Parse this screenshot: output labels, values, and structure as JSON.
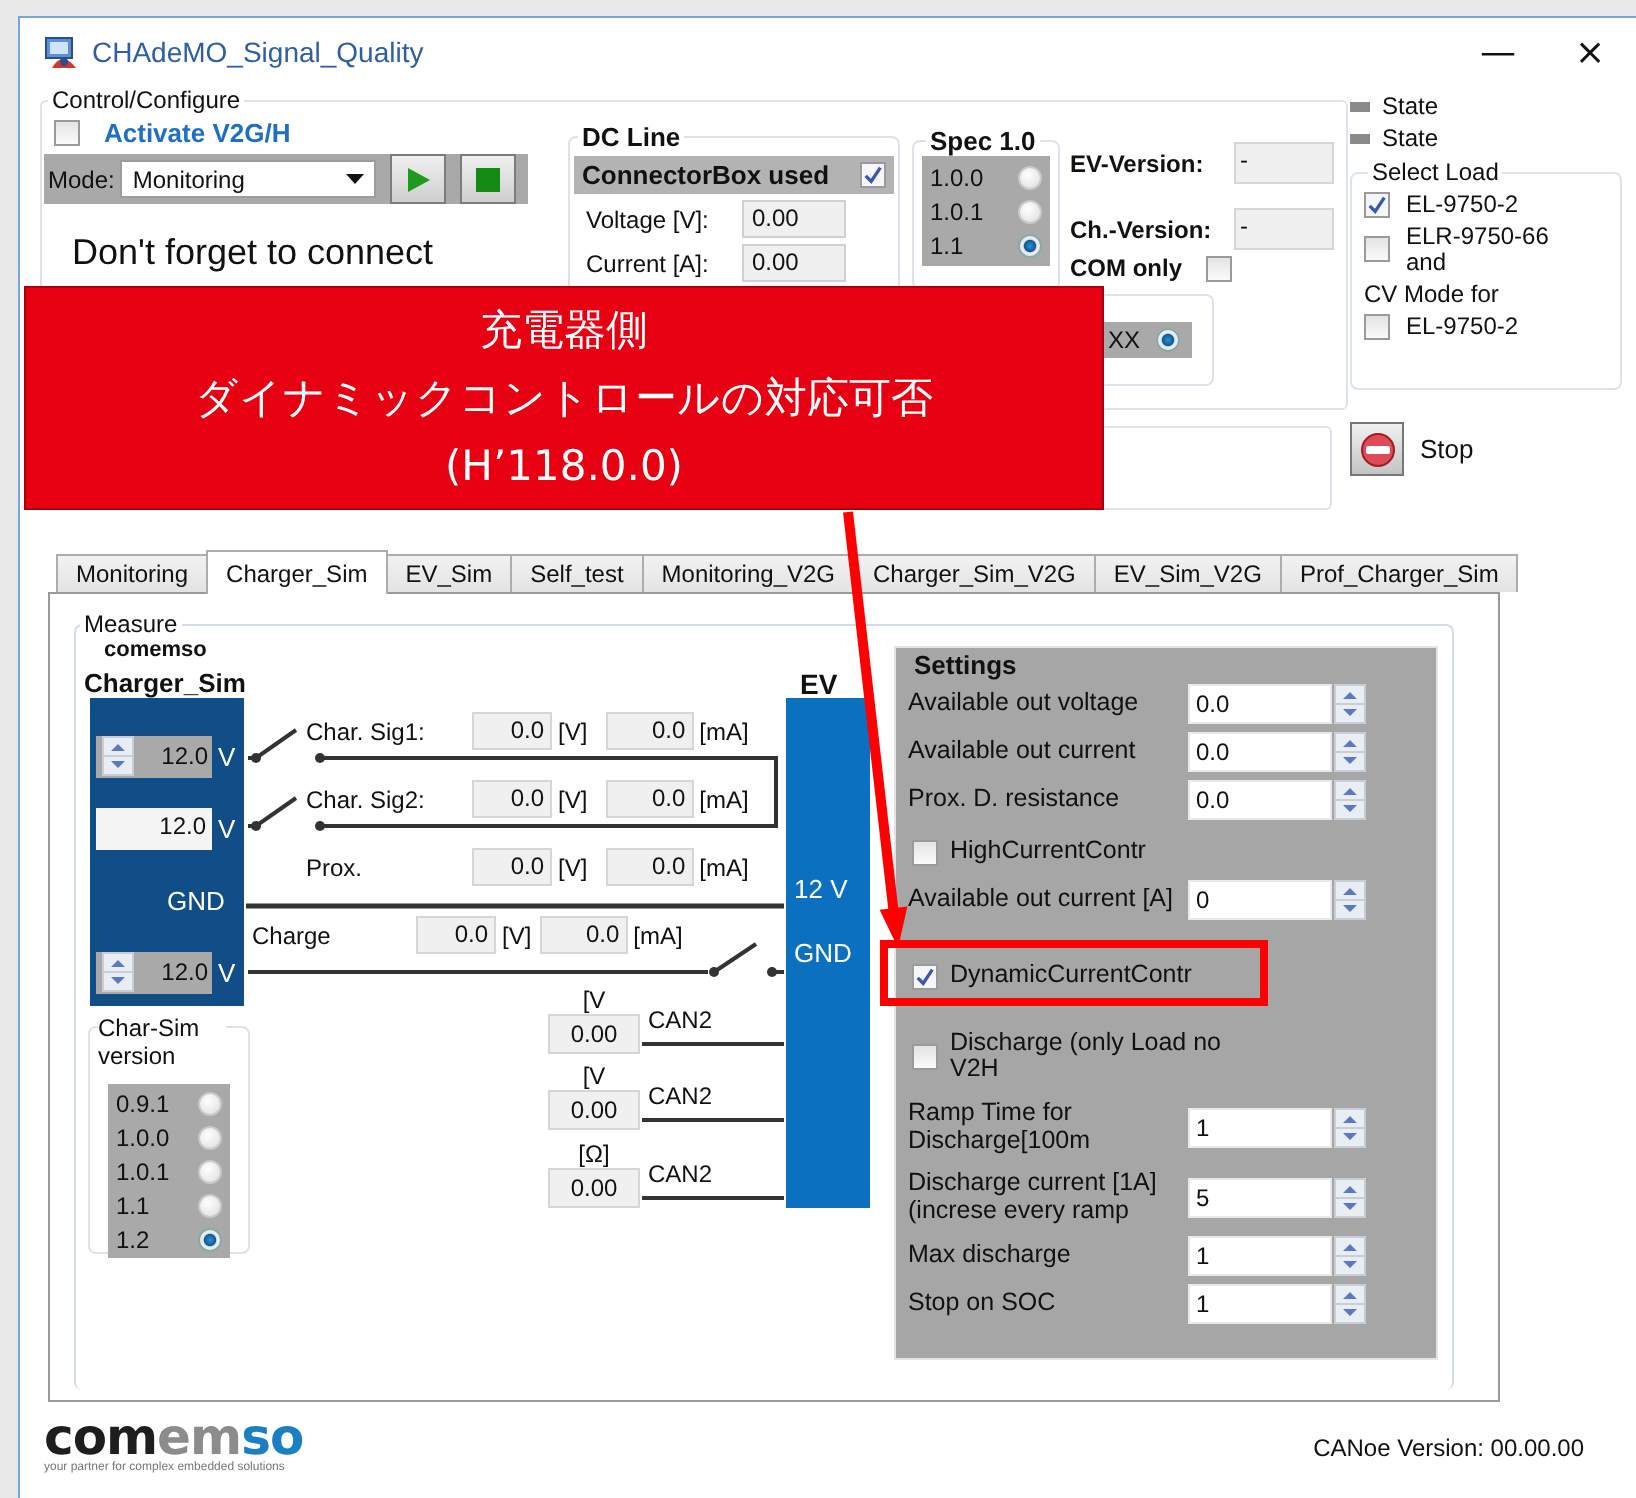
{
  "window": {
    "title": "CHAdeMO_Signal_Quality",
    "controls": [
      "—",
      "×"
    ]
  },
  "control": {
    "title": "Control/Configure",
    "activate": {
      "label": "Activate V2G/H",
      "checked": false
    },
    "mode_label": "Mode:",
    "mode_value": "Monitoring",
    "reminder": "Don't forget to connect"
  },
  "dc_line": {
    "title": "DC Line",
    "connector_box": {
      "label": "ConnectorBox used",
      "checked": true
    },
    "fields": [
      {
        "label": "Voltage [V]:",
        "value": "0.00"
      },
      {
        "label": "Current [A]:",
        "value": "0.00"
      }
    ]
  },
  "spec": {
    "title": "Spec 1.0",
    "options": [
      {
        "label": "1.0.0",
        "selected": false
      },
      {
        "label": "1.0.1",
        "selected": false
      },
      {
        "label": "1.1",
        "selected": true
      }
    ]
  },
  "versions": [
    {
      "label": "EV-Version:",
      "value": "-"
    },
    {
      "label": "Ch.-Version:",
      "value": "-"
    }
  ],
  "com_only": {
    "label": "COM only",
    "checked": false
  },
  "xx_option": {
    "label": "XX",
    "selected": true
  },
  "states": [
    "State",
    "State"
  ],
  "select_load": {
    "title": "Select Load",
    "items": [
      {
        "kind": "checkbox",
        "label": "EL-9750-2",
        "checked": true
      },
      {
        "kind": "checkbox",
        "label": "ELR-9750-66 and",
        "checked": false
      },
      {
        "kind": "text",
        "label": "CV Mode for"
      },
      {
        "kind": "checkbox",
        "label": "EL-9750-2",
        "checked": false
      }
    ]
  },
  "stop_label": "Stop",
  "tabs": [
    {
      "label": "Monitoring",
      "selected": false
    },
    {
      "label": "Charger_Sim",
      "selected": true
    },
    {
      "label": "EV_Sim",
      "selected": false
    },
    {
      "label": "Self_test",
      "selected": false
    },
    {
      "label": "Monitoring_V2G",
      "selected": false
    },
    {
      "label": "Charger_Sim_V2G",
      "selected": false
    },
    {
      "label": "EV_Sim_V2G",
      "selected": false
    },
    {
      "label": "Prof_Charger_Sim",
      "selected": false
    }
  ],
  "measure": {
    "title": "Measure",
    "charger_brand": "comemso",
    "charger_title": "Charger_Sim",
    "ev_title": "EV",
    "charger_pins": [
      {
        "kind": "spinner",
        "value": "12.0",
        "unit": "V"
      },
      {
        "kind": "field",
        "value": "12.0",
        "unit": "V"
      },
      {
        "kind": "label",
        "label": "GND"
      },
      {
        "kind": "spinner",
        "value": "12.0",
        "unit": "V"
      }
    ],
    "signals": [
      {
        "label": "Char. Sig1:",
        "voltage": "0.0",
        "voltage_unit": "[V]",
        "current": "0.0",
        "current_unit": "[mA]"
      },
      {
        "label": "Char. Sig2:",
        "voltage": "0.0",
        "voltage_unit": "[V]",
        "current": "0.0",
        "current_unit": "[mA]"
      },
      {
        "label": "Prox.",
        "voltage": "0.0",
        "voltage_unit": "[V]",
        "current": "0.0",
        "current_unit": "[mA]"
      },
      {
        "label": "Charge",
        "voltage": "0.0",
        "voltage_unit": "[V]",
        "current": "0.0",
        "current_unit": "[mA]"
      }
    ],
    "ev_pins": [
      "12 V",
      "GND"
    ],
    "can_rows": [
      {
        "unit": "[V",
        "value": "0.00",
        "label": "CAN2"
      },
      {
        "unit": "[V",
        "value": "0.00",
        "label": "CAN2"
      },
      {
        "unit": "[Ω]",
        "value": "0.00",
        "label": "CAN2"
      }
    ],
    "char_sim_version": {
      "title": "Char-Sim version",
      "options": [
        {
          "label": "0.9.1",
          "selected": false
        },
        {
          "label": "1.0.0",
          "selected": false
        },
        {
          "label": "1.0.1",
          "selected": false
        },
        {
          "label": "1.1",
          "selected": false
        },
        {
          "label": "1.2",
          "selected": true
        }
      ]
    }
  },
  "settings": {
    "title": "Settings",
    "rows": [
      {
        "kind": "number",
        "label": "Available out voltage",
        "value": "0.0"
      },
      {
        "kind": "number",
        "label": "Available out current",
        "value": "0.0"
      },
      {
        "kind": "number",
        "label": "Prox. D. resistance",
        "value": "0.0"
      },
      {
        "kind": "checkbox",
        "label": "HighCurrentContr",
        "checked": false
      },
      {
        "kind": "number",
        "label": "Available out current [A]",
        "value": "0"
      },
      {
        "kind": "checkbox",
        "label": "DynamicCurrentContr",
        "checked": true
      },
      {
        "kind": "checkbox",
        "label": "Discharge (only Load no V2H",
        "checked": false
      },
      {
        "kind": "number",
        "label": "Ramp Time for Discharge[100m",
        "value": "1"
      },
      {
        "kind": "number",
        "label": "Discharge current [1A] (increse every ramp",
        "value": "5"
      },
      {
        "kind": "number",
        "label": "Max discharge",
        "value": "1"
      },
      {
        "kind": "number",
        "label": "Stop on SOC",
        "value": "1"
      }
    ]
  },
  "logo": {
    "parts": [
      {
        "text": "com",
        "color": "#1e1e1e"
      },
      {
        "text": "em",
        "color": "#8c8c8c"
      },
      {
        "text": "so",
        "color": "#1b7fc4"
      }
    ],
    "tagline": "your partner for complex embedded solutions"
  },
  "version": "CANoe Version: 00.00.00",
  "annotation": {
    "lines": [
      "充電器側",
      "ダイナミックコントロールの対応可否",
      "(H’118.0.0)"
    ]
  }
}
